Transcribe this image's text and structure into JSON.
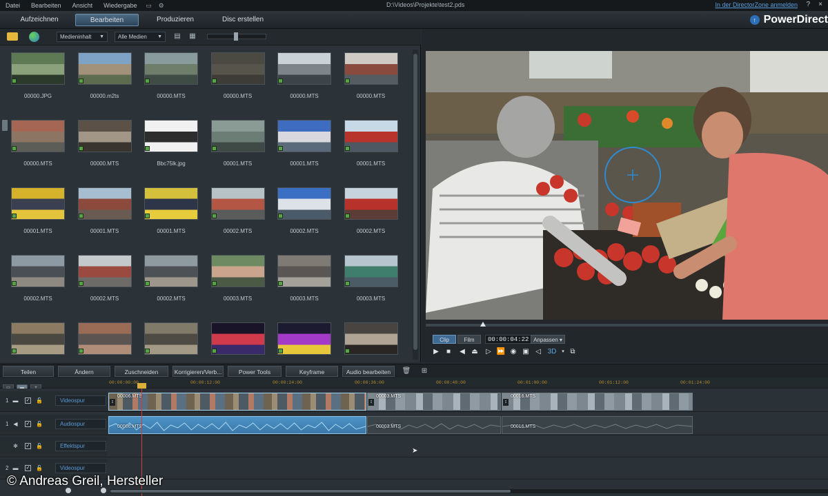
{
  "menubar": {
    "items": [
      "Datei",
      "Bearbeiten",
      "Ansicht",
      "Wiedergabe"
    ],
    "project_path": "D:\\Videos\\Projekte\\test2.pds",
    "directorzone_link": "In der DirectorZone anmelden",
    "help": "?",
    "close": "×"
  },
  "modes": {
    "tabs": [
      "Aufzeichnen",
      "Bearbeiten",
      "Produzieren",
      "Disc erstellen"
    ],
    "active": "Bearbeiten"
  },
  "brand": {
    "name": "PowerDirect"
  },
  "library": {
    "filter_content": "Medieninhalt",
    "filter_media": "Alle Medien",
    "items": [
      {
        "name": "00000.JPG",
        "colors": [
          "#5e7a55",
          "#8aa17c",
          "#2b3a2a"
        ]
      },
      {
        "name": "00000.m2ts",
        "colors": [
          "#7ea3c4",
          "#a2927c",
          "#5d6b4f"
        ]
      },
      {
        "name": "00000.MTS",
        "colors": [
          "#8a9b9e",
          "#6f7d6b",
          "#3f4c45"
        ]
      },
      {
        "name": "00000.MTS",
        "colors": [
          "#4a4a42",
          "#57554b",
          "#3d3c36"
        ]
      },
      {
        "name": "00000.MTS",
        "colors": [
          "#c9d2d6",
          "#7d858b",
          "#3c4449"
        ]
      },
      {
        "name": "00000.MTS",
        "colors": [
          "#cfcac4",
          "#8b4a3e",
          "#555d63"
        ]
      },
      {
        "name": "00000.MTS",
        "colors": [
          "#a56654",
          "#8d7564",
          "#5c5d57"
        ]
      },
      {
        "name": "00000.MTS",
        "colors": [
          "#5b5146",
          "#a29686",
          "#39342e"
        ]
      },
      {
        "name": "Bbc75lk.jpg",
        "colors": [
          "#f1f1f1",
          "#2d2d2d",
          "#f1f1f1"
        ]
      },
      {
        "name": "00001.MTS",
        "colors": [
          "#8a9b96",
          "#6c7d76",
          "#3f4a46"
        ]
      },
      {
        "name": "00001.MTS",
        "colors": [
          "#3d6cc0",
          "#d8d8de",
          "#5a6a7a"
        ]
      },
      {
        "name": "00001.MTS",
        "colors": [
          "#c7d8e6",
          "#b8332b",
          "#4e5862"
        ]
      },
      {
        "name": "00001.MTS",
        "colors": [
          "#d6b22a",
          "#3a3f52",
          "#e3c43a"
        ]
      },
      {
        "name": "00001.MTS",
        "colors": [
          "#a7bdd0",
          "#8c4a3c",
          "#6a5b52"
        ]
      },
      {
        "name": "00001.MTS",
        "colors": [
          "#d4c03a",
          "#2f3548",
          "#e6cc3c"
        ]
      },
      {
        "name": "00002.MTS",
        "colors": [
          "#b7c2c7",
          "#b35644",
          "#5a5b5b"
        ]
      },
      {
        "name": "00002.MTS",
        "colors": [
          "#3b6fc4",
          "#dde2e8",
          "#4a5a68"
        ]
      },
      {
        "name": "00002.MTS",
        "colors": [
          "#c7d3dd",
          "#b8322b",
          "#5c3c36"
        ]
      },
      {
        "name": "00002.MTS",
        "colors": [
          "#8d9aa3",
          "#4a4f55",
          "#8e8a82"
        ]
      },
      {
        "name": "00002.MTS",
        "colors": [
          "#c4c9cc",
          "#9b4a3f",
          "#6c6b67"
        ]
      },
      {
        "name": "00002.MTS",
        "colors": [
          "#8f9aa0",
          "#4c5156",
          "#9c968c"
        ]
      },
      {
        "name": "00003.MTS",
        "colors": [
          "#6d8a62",
          "#caa48c",
          "#4b5a45"
        ]
      },
      {
        "name": "00003.MTS",
        "colors": [
          "#7f7a74",
          "#5a5653",
          "#a4a09a"
        ]
      },
      {
        "name": "00003.MTS",
        "colors": [
          "#b7c6ce",
          "#3f7e6d",
          "#4c5c66"
        ]
      },
      {
        "name": "",
        "colors": [
          "#8c7b62",
          "#4a4840",
          "#a89b83"
        ]
      },
      {
        "name": "",
        "colors": [
          "#9a6c56",
          "#5c5450",
          "#b08d78"
        ]
      },
      {
        "name": "",
        "colors": [
          "#807a6a",
          "#4e4b44",
          "#a29a86"
        ]
      },
      {
        "name": "",
        "colors": [
          "#1a1428",
          "#d03a4a",
          "#3a2a6a"
        ]
      },
      {
        "name": "",
        "colors": [
          "#1c1a30",
          "#a43ac8",
          "#e6c83a"
        ]
      },
      {
        "name": "",
        "colors": [
          "#4a4440",
          "#b0a494",
          "#2a2624"
        ]
      }
    ]
  },
  "preview": {
    "tab_clip": "Clip",
    "tab_film": "Film",
    "timecode": "00:00:04:22",
    "fit_label": "Anpassen",
    "seek_progress": 0.135
  },
  "timeline_toolbar": {
    "buttons": [
      "Teilen",
      "Ändern",
      "Zuschneiden",
      "Korrigieren/Verb...",
      "Power Tools",
      "Keyframe",
      "Audio bearbeiten"
    ]
  },
  "ruler": {
    "ticks": [
      "00:00:00:00",
      "00:00:12:00",
      "00:00:24:00",
      "00:00:36:00",
      "00:00:48:00",
      "00:01:00:00",
      "00:01:12:00",
      "00:01:24:00"
    ]
  },
  "tracks": [
    {
      "num": "1",
      "label": "Videospur"
    },
    {
      "num": "1",
      "label": "Audiospur"
    },
    {
      "num": "",
      "label": "Effektspur"
    },
    {
      "num": "2",
      "label": "Videospur"
    }
  ],
  "clips": {
    "video": [
      "00006.MTS",
      "00003.MTS",
      "00016.MTS"
    ],
    "audio": [
      "00006.MTS",
      "00003.MTS",
      "00016.MTS"
    ]
  },
  "credit": "© Andreas Greil, Hersteller"
}
